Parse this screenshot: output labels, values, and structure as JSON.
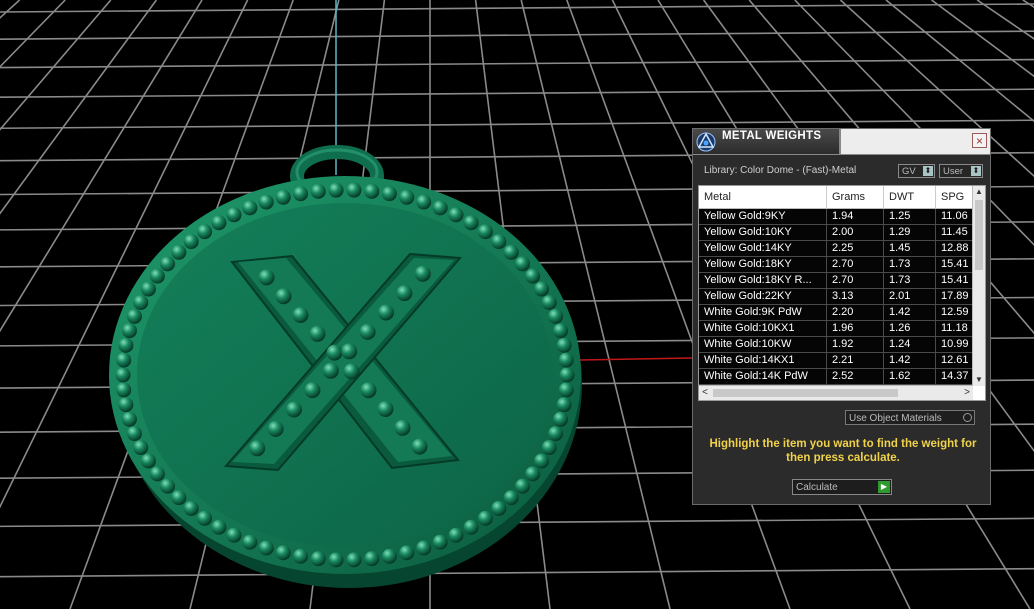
{
  "scene": {
    "model_name": "pendant-x-model",
    "colors": {
      "background": "#000000",
      "grid": "#9a9a9a",
      "axis_y": "#5fb6c8",
      "axis_x": "#c01818",
      "model": "#0f6e4e",
      "model_highlight": "#2fa57a",
      "model_shadow": "#053a28"
    }
  },
  "panel": {
    "title": "METAL WEIGHTS",
    "close_glyph": "×",
    "library_label": "Library: Color Dome - (Fast)-Metal",
    "gv_select": "GV",
    "user_select": "User",
    "knob_glyph": "⬍",
    "columns": [
      "Metal",
      "Grams",
      "DWT",
      "SPG"
    ],
    "rows": [
      [
        "Yellow Gold:9KY",
        "1.94",
        "1.25",
        "11.06"
      ],
      [
        "Yellow Gold:10KY",
        "2.00",
        "1.29",
        "11.45"
      ],
      [
        "Yellow Gold:14KY",
        "2.25",
        "1.45",
        "12.88"
      ],
      [
        "Yellow Gold:18KY",
        "2.70",
        "1.73",
        "15.41"
      ],
      [
        "Yellow Gold:18KY R...",
        "2.70",
        "1.73",
        "15.41"
      ],
      [
        "Yellow Gold:22KY",
        "3.13",
        "2.01",
        "17.89"
      ],
      [
        "White Gold:9K PdW",
        "2.20",
        "1.42",
        "12.59"
      ],
      [
        "White Gold:10KX1",
        "1.96",
        "1.26",
        "11.18"
      ],
      [
        "White Gold:10KW",
        "1.92",
        "1.24",
        "10.99"
      ],
      [
        "White Gold:14KX1",
        "2.21",
        "1.42",
        "12.61"
      ],
      [
        "White Gold:14K PdW",
        "2.52",
        "1.62",
        "14.37"
      ]
    ],
    "use_object_materials": "Use Object Materials",
    "instructions": "Highlight the item you want to find the weight for then press calculate.",
    "calculate_label": "Calculate",
    "calculate_icon": "▶",
    "scroll_up": "▲",
    "scroll_down": "▼",
    "scroll_left": "<",
    "scroll_right": ">"
  }
}
